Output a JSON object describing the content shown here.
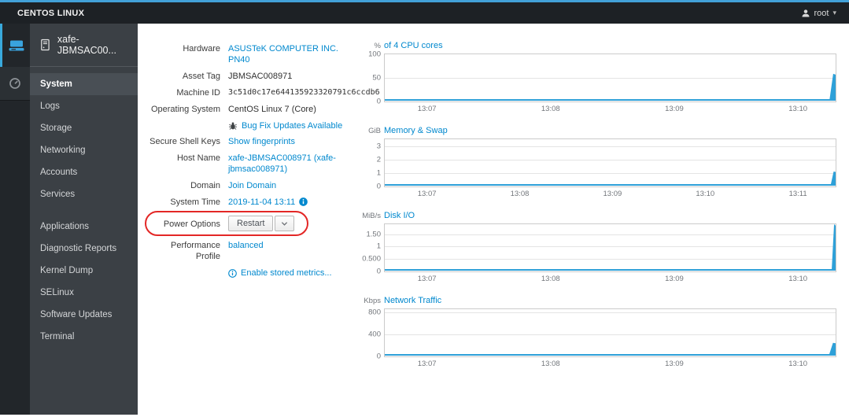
{
  "topbar": {
    "brand": "CENTOS LINUX",
    "user": "root"
  },
  "sidebar": {
    "host": "xafe-JBMSAC00...",
    "active": "System",
    "group1": [
      "System",
      "Logs",
      "Storage",
      "Networking",
      "Accounts",
      "Services"
    ],
    "group2": [
      "Applications",
      "Diagnostic Reports",
      "Kernel Dump",
      "SELinux",
      "Software Updates",
      "Terminal"
    ]
  },
  "details": {
    "rows": [
      {
        "name": "hardware",
        "label": "Hardware",
        "type": "link",
        "value": "ASUSTeK COMPUTER INC. PN40"
      },
      {
        "name": "asset-tag",
        "label": "Asset Tag",
        "type": "text",
        "value": "JBMSAC008971"
      },
      {
        "name": "machine-id",
        "label": "Machine ID",
        "type": "mono",
        "value": "3c51d0c17e644135923320791c6ccdb6"
      },
      {
        "name": "operating-system",
        "label": "Operating System",
        "type": "text",
        "value": "CentOS Linux 7 (Core)"
      },
      {
        "name": "bug-fix-updates",
        "label": "",
        "type": "link",
        "icon": "bug",
        "value": "Bug Fix Updates Available"
      },
      {
        "name": "ssh-keys",
        "label": "Secure Shell Keys",
        "type": "link",
        "value": "Show fingerprints"
      },
      {
        "name": "host-name",
        "label": "Host Name",
        "type": "link",
        "value": "xafe-JBMSAC008971 (xafe-jbmsac008971)"
      },
      {
        "name": "domain",
        "label": "Domain",
        "type": "link",
        "value": "Join Domain"
      },
      {
        "name": "system-time",
        "label": "System Time",
        "type": "link",
        "value": "2019-11-04 13:11",
        "icon_after": "info-filled"
      },
      {
        "name": "power-options",
        "label": "Power Options",
        "type": "button",
        "value": "Restart",
        "annotated": true
      },
      {
        "name": "performance-profile",
        "label": "Performance Profile",
        "type": "link",
        "value": "balanced"
      },
      {
        "name": "stored-metrics",
        "label": "",
        "type": "link",
        "icon": "info-outline",
        "value": "Enable stored metrics..."
      }
    ]
  },
  "annotation": {
    "shape": "rounded-rect",
    "color": "#e32726",
    "target": "power-options-row"
  },
  "chart_data": [
    {
      "type": "area",
      "title": "of 4 CPU cores",
      "ylabel": "%",
      "ymax": 100,
      "grid": true,
      "legend": "none",
      "yticks": [
        {
          "label": "100",
          "value": 100
        },
        {
          "label": "50",
          "value": 50
        },
        {
          "label": "0",
          "value": 0
        }
      ],
      "x": [
        "13:07",
        "13:08",
        "13:09",
        "13:10"
      ],
      "baseline_value": 0,
      "spike_value": 57,
      "spike_width": 11
    },
    {
      "type": "area",
      "title": "Memory & Swap",
      "ylabel": "GiB",
      "ymax": 3.5,
      "grid": true,
      "legend": "none",
      "yticks": [
        {
          "label": "3",
          "value": 3
        },
        {
          "label": "2",
          "value": 2
        },
        {
          "label": "1",
          "value": 1
        },
        {
          "label": "0",
          "value": 0
        }
      ],
      "x": [
        "13:07",
        "13:08",
        "13:09",
        "13:10",
        "13:11"
      ],
      "baseline_value": 0,
      "spike_value": 1.05,
      "spike_width": 9
    },
    {
      "type": "area",
      "title": "Disk I/O",
      "ylabel": "MiB/s",
      "ymax": 1.9,
      "grid": true,
      "legend": "none",
      "yticks": [
        {
          "label": "1.50",
          "value": 1.5
        },
        {
          "label": "1",
          "value": 1
        },
        {
          "label": "0.500",
          "value": 0.5
        },
        {
          "label": "0",
          "value": 0
        }
      ],
      "x": [
        "13:07",
        "13:08",
        "13:09",
        "13:10"
      ],
      "baseline_value": 0,
      "spike_value": 1.87,
      "spike_width": 7
    },
    {
      "type": "area",
      "title": "Network Traffic",
      "ylabel": "Kbps",
      "ymax": 850,
      "grid": true,
      "legend": "none",
      "yticks": [
        {
          "label": "800",
          "value": 800
        },
        {
          "label": "400",
          "value": 400
        },
        {
          "label": "0",
          "value": 0
        }
      ],
      "x": [
        "13:07",
        "13:08",
        "13:09",
        "13:10"
      ],
      "baseline_value": 0,
      "spike_value": 230,
      "spike_width": 12
    }
  ],
  "colors": {
    "accent_blue": "#39a9dc",
    "link": "#0088ce",
    "series": "#2ea0d8",
    "topbar_bg": "#1d2125",
    "sidebar_bg": "#3b4045",
    "iconstrip_bg": "#22262a",
    "active_item_bg": "#494f55",
    "annotation_red": "#e32726"
  },
  "icons": [
    "server-icon",
    "dashboard-gauge-icon",
    "host-doc-icon",
    "bug-icon",
    "info-filled-icon",
    "info-outline-icon",
    "user-icon",
    "chevron-down-icon"
  ]
}
